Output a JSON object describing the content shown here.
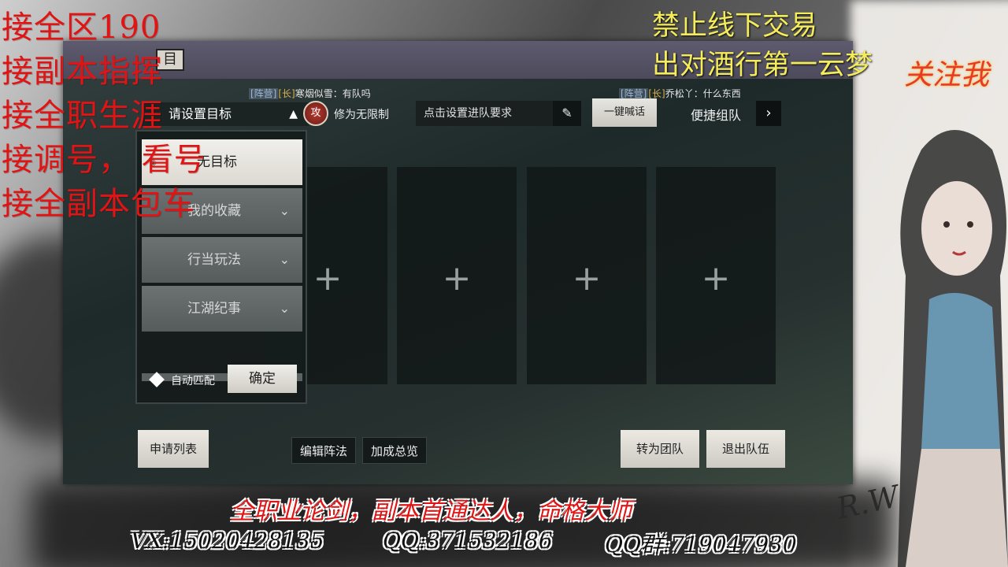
{
  "overlay": {
    "left_ads": [
      "接全区190",
      "接副本指挥",
      "接全职生涯",
      "接调号，  看号",
      "接全副本包车"
    ],
    "top_right_ads": [
      "禁止线下交易",
      "出对酒行第一云梦"
    ],
    "follow_tag": "关注我",
    "bottom_banner": "全职业论剑，副本首通达人，命格大师",
    "contacts": {
      "vx": "VX:15020428135",
      "qq": "QQ:371532186",
      "qq_group": "QQ群:719047930"
    }
  },
  "game": {
    "chat": [
      {
        "camp": "[阵营]",
        "rank": "[长]",
        "text": "寒烟似雪：有队吗"
      },
      {
        "camp": "[阵营]",
        "rank": "[长]",
        "text": "乔松丫：什么东西"
      }
    ],
    "target_select": {
      "label": "请设置目标",
      "caret": "▲"
    },
    "attack_badge": "攻",
    "modify_label": "修为无限制",
    "requirement_field": "点击设置进队要求",
    "shout_button": "一键喊话",
    "quick_team": {
      "label": "便捷组队",
      "arrow": "›"
    },
    "slots": [
      "+",
      "+",
      "+",
      "+",
      "+"
    ],
    "dropdown": {
      "items": [
        {
          "label": "无目标",
          "selected": true
        },
        {
          "label": "我的收藏",
          "selected": false
        },
        {
          "label": "行当玩法",
          "selected": false
        },
        {
          "label": "江湖纪事",
          "selected": false
        }
      ],
      "auto_match": "自动匹配",
      "confirm": "确定"
    },
    "bottom": {
      "apply_list": "申请列表",
      "edit_formation": "编辑阵法",
      "bonus_overview": "加成总览",
      "to_raid": "转为团队",
      "leave_team": "退出队伍"
    }
  }
}
